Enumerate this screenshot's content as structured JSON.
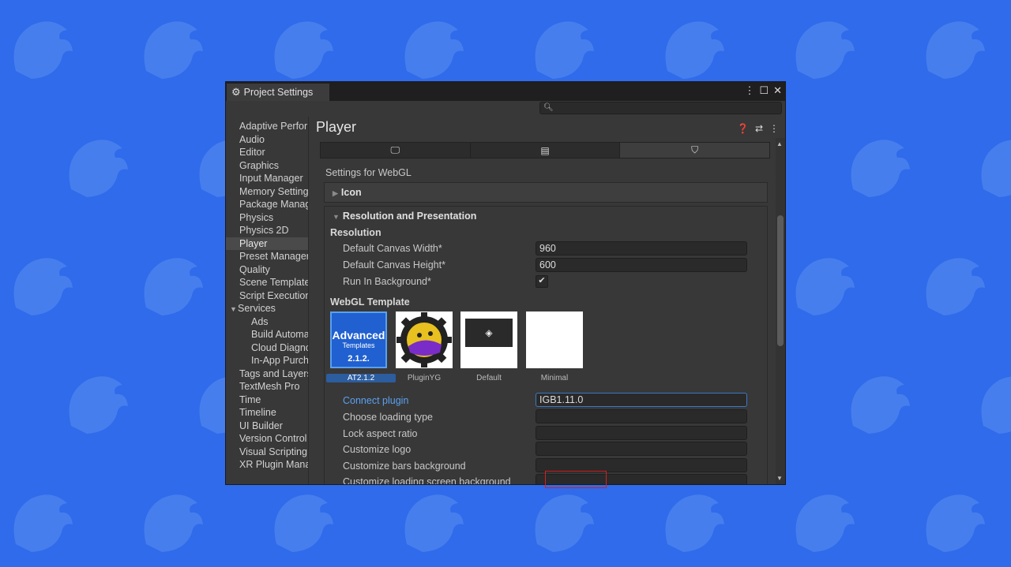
{
  "window": {
    "tab_title": "Project Settings",
    "buttons": [
      "⋮",
      "☐",
      "✕"
    ]
  },
  "sidebar": {
    "items": [
      {
        "label": "Adaptive Performance"
      },
      {
        "label": "Audio"
      },
      {
        "label": "Editor"
      },
      {
        "label": "Graphics"
      },
      {
        "label": "Input Manager"
      },
      {
        "label": "Memory Settings"
      },
      {
        "label": "Package Manager"
      },
      {
        "label": "Physics"
      },
      {
        "label": "Physics 2D"
      },
      {
        "label": "Player"
      },
      {
        "label": "Preset Manager"
      },
      {
        "label": "Quality"
      },
      {
        "label": "Scene Template"
      },
      {
        "label": "Script Execution Order"
      },
      {
        "label": "Services"
      },
      {
        "label": "Ads"
      },
      {
        "label": "Build Automation"
      },
      {
        "label": "Cloud Diagnostics"
      },
      {
        "label": "In-App Purchasing"
      },
      {
        "label": "Tags and Layers"
      },
      {
        "label": "TextMesh Pro"
      },
      {
        "label": "Time"
      },
      {
        "label": "Timeline"
      },
      {
        "label": "UI Builder"
      },
      {
        "label": "Version Control"
      },
      {
        "label": "Visual Scripting"
      },
      {
        "label": "XR Plugin Management"
      }
    ]
  },
  "content": {
    "title": "Player",
    "settings_for": "Settings for WebGL",
    "icon_section": "Icon",
    "resolution_section": "Resolution and Presentation",
    "resolution_header": "Resolution",
    "canvas_width_label": "Default Canvas Width*",
    "canvas_width_value": "960",
    "canvas_height_label": "Default Canvas Height*",
    "canvas_height_value": "600",
    "run_bg_label": "Run In Background*",
    "webgl_template_header": "WebGL Template",
    "templates": [
      {
        "name": "AT2.1.2",
        "line1": "Advanced",
        "line2": "Templates",
        "line3": "2.1.2."
      },
      {
        "name": "PluginYG"
      },
      {
        "name": "Default"
      },
      {
        "name": "Minimal"
      }
    ],
    "connect_plugin_label": "Connect plugin",
    "connect_plugin_value": "IGB1.11.0",
    "choose_loading_label": "Choose loading type",
    "lock_aspect_label": "Lock aspect ratio",
    "customize_logo_label": "Customize logo",
    "customize_bars_label": "Customize bars background",
    "customize_loading_label": "Customize loading screen background"
  }
}
